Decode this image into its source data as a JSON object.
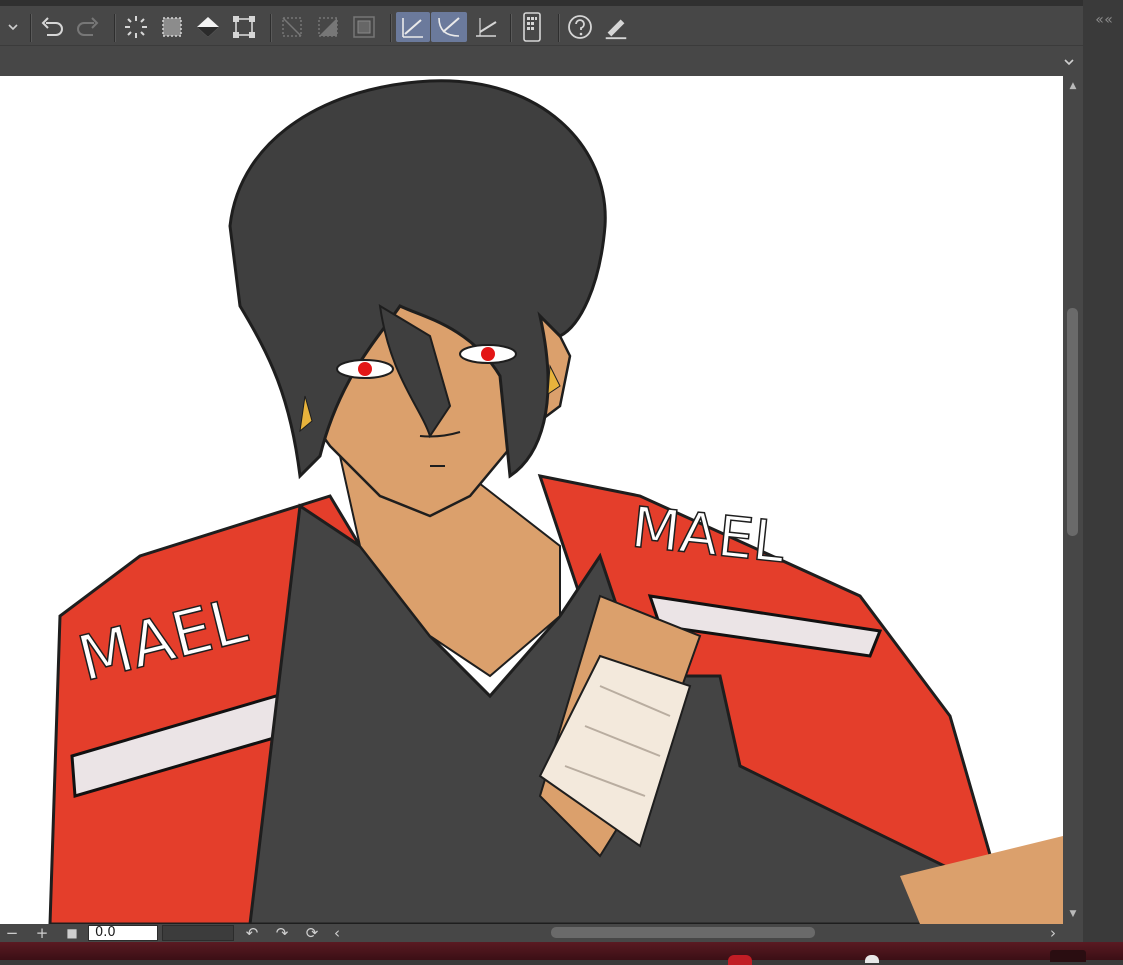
{
  "app": {
    "accent_color": "#6b7a9c"
  },
  "toolbar": {
    "buttons": [
      {
        "name": "dropdown-chevron-icon"
      },
      {
        "name": "undo-icon"
      },
      {
        "name": "redo-icon"
      },
      {
        "name": "clear-selection-icon"
      },
      {
        "name": "invert-selection-icon"
      },
      {
        "name": "fill-icon"
      },
      {
        "name": "transform-icon"
      },
      {
        "name": "crop-outside-icon"
      },
      {
        "name": "mask-outside-icon"
      },
      {
        "name": "expand-selection-icon"
      },
      {
        "name": "ruler-snap-icon",
        "active": true
      },
      {
        "name": "special-ruler-snap-icon",
        "active": true
      },
      {
        "name": "grid-snap-icon"
      },
      {
        "name": "companion-mode-icon"
      },
      {
        "name": "help-icon"
      },
      {
        "name": "pen-settings-icon"
      }
    ]
  },
  "panel": {
    "collapse_glyph": "« «"
  },
  "bottombar": {
    "zoom_out": "−",
    "zoom_in": "+",
    "fit": "■",
    "rotation_value": "0.0",
    "rotate_left": "↶",
    "rotate_right": "↷",
    "reset_rotation": "⟳",
    "scroll_left": "‹",
    "scroll_right": "›"
  },
  "canvas": {
    "description_colors": {
      "jacket": "#e43e2b",
      "shirt": "#444444",
      "skin": "#dba06c",
      "hair": "#3f3f3f",
      "eyes": "#e31616"
    },
    "lettering_left": "MAEL",
    "lettering_right": "MAEL"
  }
}
